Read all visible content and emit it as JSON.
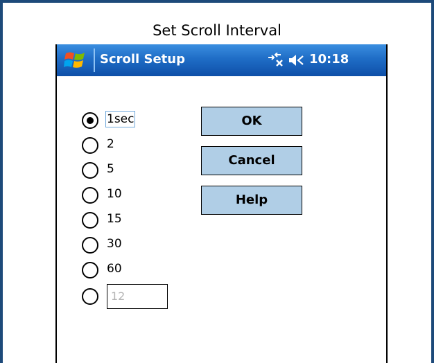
{
  "caption": "Set Scroll Interval",
  "titlebar": {
    "title": "Scroll Setup",
    "time": "10:18",
    "icons": [
      "windows-start-icon",
      "connectivity-icon",
      "volume-muted-icon"
    ]
  },
  "intervals": {
    "options": [
      "1sec",
      "2",
      "5",
      "10",
      "15",
      "30",
      "60"
    ],
    "selected": "1sec",
    "custom_value": "12"
  },
  "buttons": {
    "ok": "OK",
    "cancel": "Cancel",
    "help": "Help"
  },
  "colors": {
    "frame_border": "#1d4a7a",
    "titlebar": "#1f6dc6",
    "button_face": "#b0cee6"
  }
}
